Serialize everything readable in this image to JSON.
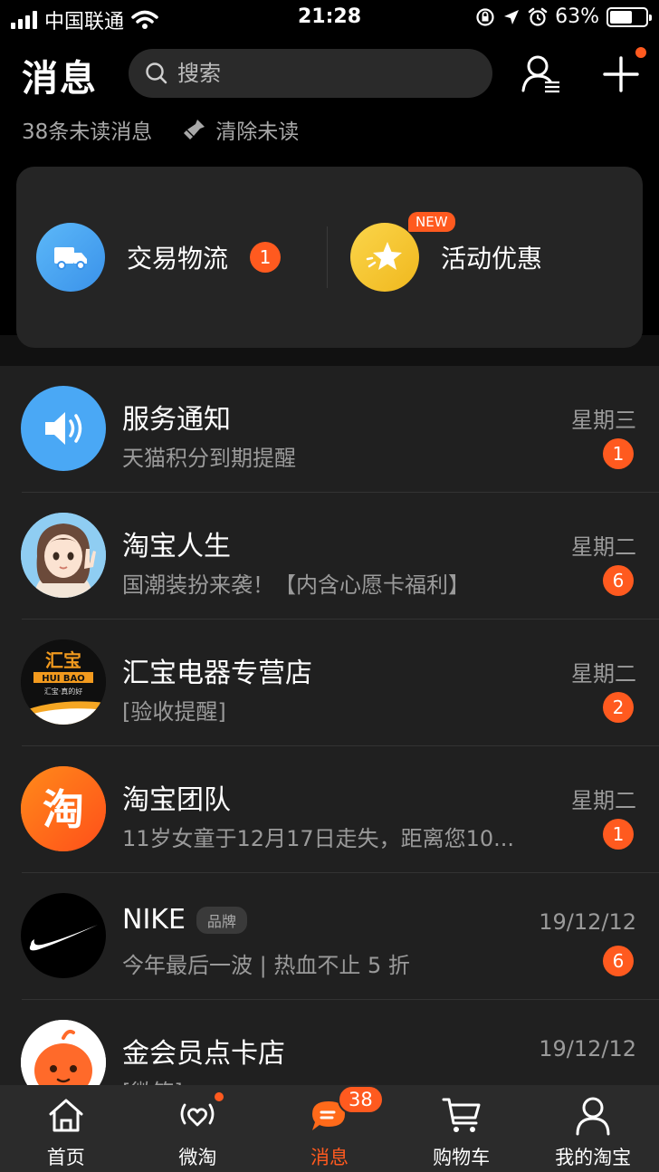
{
  "status_bar": {
    "carrier": "中国联通",
    "time": "21:28",
    "battery": "63%",
    "battery_level": 0.63
  },
  "header": {
    "title": "消息",
    "search_placeholder": "搜索",
    "unread_text": "38条未读消息",
    "clear_label": "清除未读"
  },
  "quick": {
    "items": [
      {
        "label": "交易物流",
        "count": "1",
        "icon": "truck-icon",
        "color": "#4aa8f5"
      },
      {
        "label": "活动优惠",
        "tag": "NEW",
        "icon": "star-icon",
        "color": "#f4c531"
      }
    ]
  },
  "messages": [
    {
      "title": "服务通知",
      "preview": "天猫积分到期提醒",
      "time": "星期三",
      "count": "1",
      "avatar": "speaker-icon"
    },
    {
      "title": "淘宝人生",
      "preview": "国潮装扮来袭！【内含心愿卡福利】",
      "time": "星期二",
      "count": "6",
      "avatar": "girl-avatar"
    },
    {
      "title": "汇宝电器专营店",
      "preview": "[验收提醒]",
      "time": "星期二",
      "count": "2",
      "avatar": "huibao-logo",
      "logo_text": "汇宝",
      "logo_sub": "HUI BAO",
      "logo_slogan": "汇宝·真的好"
    },
    {
      "title": "淘宝团队",
      "preview": "11岁女童于12月17日走失，距离您10...",
      "time": "星期二",
      "count": "1",
      "avatar": "tao-logo",
      "logo_text": "淘"
    },
    {
      "title": "NIKE",
      "tag": "品牌",
      "preview": "今年最后一波 | 热血不止 5 折",
      "time": "19/12/12",
      "count": "6",
      "avatar": "nike-logo"
    },
    {
      "title": "金会员点卡店",
      "preview": "[微笑]",
      "time": "19/12/12",
      "avatar": "mascot-avatar"
    }
  ],
  "tabs": [
    {
      "label": "首页",
      "icon": "home-icon"
    },
    {
      "label": "微淘",
      "icon": "weitao-icon",
      "dot": true
    },
    {
      "label": "消息",
      "icon": "message-icon",
      "badge": "38",
      "active": true
    },
    {
      "label": "购物车",
      "icon": "cart-icon"
    },
    {
      "label": "我的淘宝",
      "icon": "user-icon"
    }
  ]
}
